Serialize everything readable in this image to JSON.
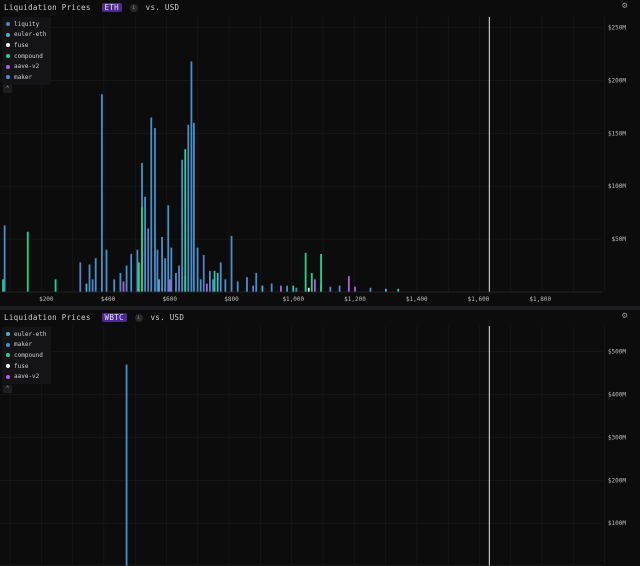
{
  "colors": {
    "liquity": "#5b7fc4",
    "euler-eth": "#4fb0cf",
    "fuse": "#f2f2f2",
    "compound": "#25d18f",
    "aave-v2": "#b15fe0",
    "maker": "#4a8fc7",
    "background": "#0c0c0d",
    "grid": "#1b1b1e",
    "accent_pill": "#4b2a8c",
    "marker_line": "#e6e6e6"
  },
  "icons": {
    "settings": "gear-icon",
    "collapse": "chevron-up-icon",
    "info": "info-icon"
  },
  "chart_data": [
    {
      "type": "bar",
      "title": "Liquidation Prices",
      "asset": "ETH",
      "info": "i",
      "quote": "vs. USD",
      "legend_position": "top-left",
      "grid": true,
      "xlim": [
        50,
        2000
      ],
      "ylim": [
        0,
        260
      ],
      "x_ticks": [
        {
          "v": 200,
          "label": "$200"
        },
        {
          "v": 400,
          "label": "$400"
        },
        {
          "v": 600,
          "label": "$600"
        },
        {
          "v": 800,
          "label": "$800"
        },
        {
          "v": 1000,
          "label": "$1,000"
        },
        {
          "v": 1200,
          "label": "$1,200"
        },
        {
          "v": 1400,
          "label": "$1,400"
        },
        {
          "v": 1600,
          "label": "$1,600"
        },
        {
          "v": 1800,
          "label": "$1,800"
        }
      ],
      "y_ticks": [
        {
          "v": 50,
          "label": "$50M"
        },
        {
          "v": 100,
          "label": "$100M"
        },
        {
          "v": 150,
          "label": "$150M"
        },
        {
          "v": 200,
          "label": "$200M"
        },
        {
          "v": 250,
          "label": "$250M"
        }
      ],
      "marker_x": 1635,
      "legend": [
        "liquity",
        "euler-eth",
        "fuse",
        "compound",
        "aave-v2",
        "maker"
      ],
      "series": [
        {
          "name": "maker",
          "points": [
            [
              65,
              63
            ],
            [
              380,
              187
            ],
            [
              395,
              40
            ],
            [
              460,
              25
            ],
            [
              475,
              36
            ],
            [
              495,
              40
            ],
            [
              510,
              122
            ],
            [
              520,
              90
            ],
            [
              540,
              165
            ],
            [
              552,
              155
            ],
            [
              575,
              52
            ],
            [
              585,
              32
            ],
            [
              595,
              82
            ],
            [
              605,
              42
            ],
            [
              640,
              125
            ],
            [
              660,
              158
            ],
            [
              670,
              218
            ],
            [
              678,
              160
            ],
            [
              690,
              42
            ],
            [
              730,
              20
            ],
            [
              765,
              28
            ],
            [
              780,
              12
            ],
            [
              800,
              53
            ],
            [
              340,
              26
            ],
            [
              360,
              32
            ],
            [
              420,
              12
            ],
            [
              440,
              18
            ],
            [
              620,
              18
            ],
            [
              700,
              12
            ],
            [
              820,
              10
            ],
            [
              850,
              14
            ],
            [
              880,
              18
            ],
            [
              930,
              8
            ],
            [
              980,
              6
            ],
            [
              1090,
              7
            ],
            [
              1150,
              6
            ],
            [
              1250,
              4
            ]
          ]
        },
        {
          "name": "liquity",
          "points": [
            [
              310,
              28
            ],
            [
              350,
              12
            ],
            [
              530,
              60
            ],
            [
              560,
              40
            ],
            [
              630,
              25
            ],
            [
              710,
              35
            ],
            [
              740,
              12
            ],
            [
              870,
              6
            ],
            [
              1010,
              4
            ],
            [
              1120,
              5
            ]
          ]
        },
        {
          "name": "euler-eth",
          "points": [
            [
              330,
              8
            ],
            [
              565,
              12
            ],
            [
              650,
              15
            ],
            [
              755,
              18
            ],
            [
              900,
              6
            ],
            [
              1300,
              3
            ]
          ]
        },
        {
          "name": "compound",
          "points": [
            [
              60,
              12
            ],
            [
              140,
              57
            ],
            [
              230,
              12
            ],
            [
              500,
              28
            ],
            [
              510,
              80
            ],
            [
              650,
              135
            ],
            [
              745,
              20
            ],
            [
              1040,
              37
            ],
            [
              1060,
              18
            ],
            [
              1090,
              36
            ],
            [
              1000,
              6
            ],
            [
              1340,
              3
            ]
          ]
        },
        {
          "name": "aave-v2",
          "points": [
            [
              450,
              10
            ],
            [
              600,
              12
            ],
            [
              720,
              8
            ],
            [
              960,
              6
            ],
            [
              1070,
              12
            ],
            [
              1180,
              15
            ],
            [
              1200,
              5
            ]
          ]
        },
        {
          "name": "fuse",
          "points": [
            [
              1050,
              4
            ]
          ]
        }
      ]
    },
    {
      "type": "bar",
      "title": "Liquidation Prices",
      "asset": "WBTC",
      "info": "i",
      "quote": "vs. USD",
      "legend_position": "top-left",
      "grid": true,
      "xlim": [
        50,
        2000
      ],
      "ylim": [
        0,
        560
      ],
      "x_ticks": [],
      "y_ticks": [
        {
          "v": 100,
          "label": "$100M"
        },
        {
          "v": 200,
          "label": "$200M"
        },
        {
          "v": 300,
          "label": "$300M"
        },
        {
          "v": 400,
          "label": "$400M"
        },
        {
          "v": 500,
          "label": "$500M"
        }
      ],
      "marker_x": 1635,
      "legend": [
        "euler-eth",
        "maker",
        "compound",
        "fuse",
        "aave-v2"
      ],
      "series": [
        {
          "name": "maker",
          "points": [
            [
              460,
              470
            ]
          ]
        }
      ]
    }
  ]
}
